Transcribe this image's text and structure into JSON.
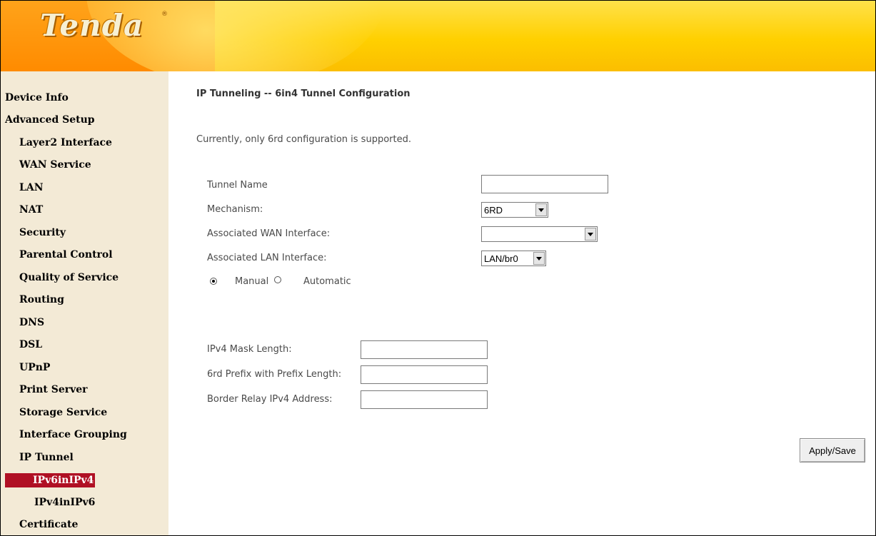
{
  "header": {
    "logo_text": "Tenda",
    "logo_mark": "®",
    "brand_color": "#ffd000"
  },
  "sidebar": {
    "active_color": "#b01024",
    "items": [
      {
        "label": "Device Info"
      },
      {
        "label": "Advanced Setup"
      },
      {
        "label": "Layer2 Interface"
      },
      {
        "label": "WAN Service"
      },
      {
        "label": "LAN"
      },
      {
        "label": "NAT"
      },
      {
        "label": "Security"
      },
      {
        "label": "Parental Control"
      },
      {
        "label": "Quality of Service"
      },
      {
        "label": "Routing"
      },
      {
        "label": "DNS"
      },
      {
        "label": "DSL"
      },
      {
        "label": "UPnP"
      },
      {
        "label": "Print Server"
      },
      {
        "label": "Storage Service"
      },
      {
        "label": "Interface Grouping"
      },
      {
        "label": "IP Tunnel"
      },
      {
        "label": "IPv6inIPv4",
        "active": true
      },
      {
        "label": "IPv4inIPv6"
      },
      {
        "label": "Certificate"
      }
    ]
  },
  "main": {
    "title": "IP Tunneling -- 6in4 Tunnel Configuration",
    "note": "Currently, only 6rd configuration is supported.",
    "tunnel_name": {
      "label": "Tunnel Name",
      "value": ""
    },
    "mechanism": {
      "label": "Mechanism:",
      "value": "6RD"
    },
    "wan_interface": {
      "label": "Associated WAN Interface:",
      "value": ""
    },
    "lan_interface": {
      "label": "Associated LAN Interface:",
      "value": "LAN/br0"
    },
    "mode": {
      "manual_label": "Manual",
      "automatic_label": "Automatic",
      "selected": "Manual"
    },
    "ipv4_mask_length": {
      "label": "IPv4 Mask Length:",
      "value": ""
    },
    "prefix_6rd": {
      "label": "6rd Prefix with Prefix Length:",
      "value": ""
    },
    "border_relay": {
      "label": "Border Relay IPv4 Address:",
      "value": ""
    },
    "apply_label": "Apply/Save"
  }
}
